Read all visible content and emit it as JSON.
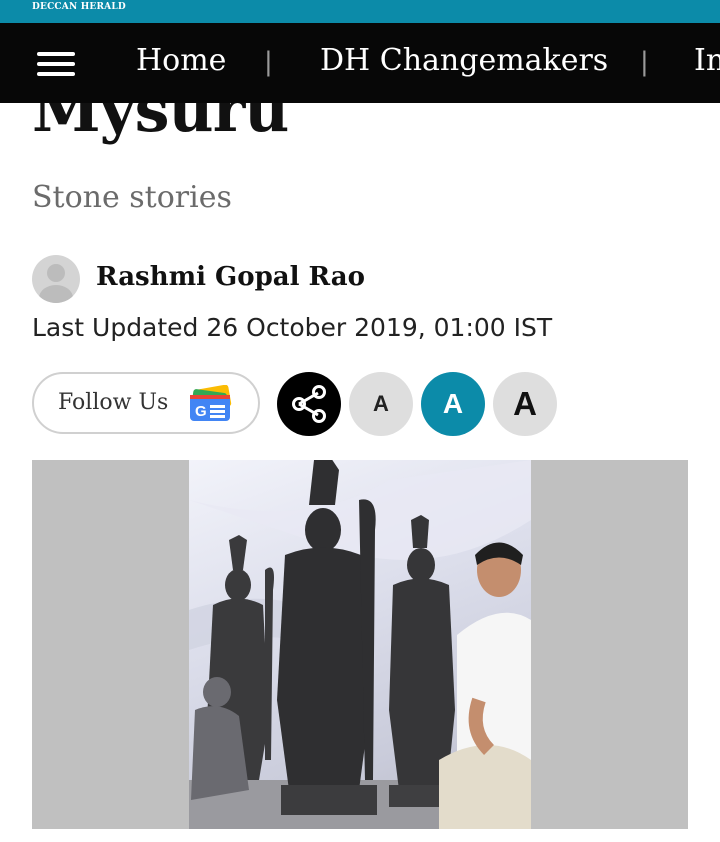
{
  "brand": {
    "name": "DECCAN HERALD"
  },
  "nav": {
    "items": [
      {
        "label": "Home"
      },
      {
        "label": "DH Changemakers"
      },
      {
        "label": "In"
      }
    ],
    "separator": "|"
  },
  "article": {
    "title": "Mysuru",
    "subtitle": "Stone stories",
    "author": "Rashmi Gopal Rao",
    "updated": "Last Updated 26 October 2019, 01:00 IST"
  },
  "actions": {
    "follow_label": "Follow Us",
    "google_news_badge": "G",
    "font_small": "A",
    "font_medium": "A",
    "font_large": "A"
  },
  "colors": {
    "accent": "#0c8ba9",
    "nav_bg": "#070707",
    "image_frame": "#c0c0c0"
  },
  "icons": [
    "menu-icon",
    "share-icon",
    "google-news-icon",
    "avatar-placeholder-icon"
  ]
}
